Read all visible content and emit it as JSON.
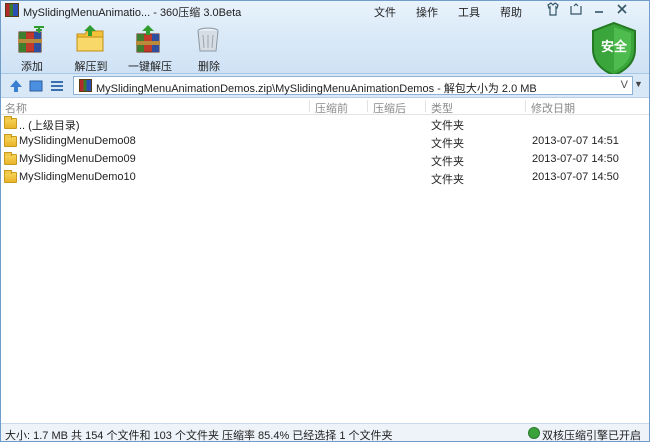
{
  "window": {
    "title": "MySlidingMenuAnimatio... - 360压缩 3.0Beta"
  },
  "menu": {
    "items": [
      "文件",
      "操作",
      "工具",
      "帮助"
    ]
  },
  "toolbar": {
    "add_label": "添加",
    "extract_to_label": "解压到",
    "one_click_extract_label": "一键解压",
    "delete_label": "删除"
  },
  "security": {
    "label": "安全"
  },
  "address": {
    "path": "MySlidingMenuAnimationDemos.zip\\MySlidingMenuAnimationDemos - 解包大小为 2.0 MB",
    "dropdown_glyph": "V"
  },
  "columns": {
    "name": "名称",
    "compressed": "压缩前",
    "after": "压缩后",
    "type": "类型",
    "modified": "修改日期"
  },
  "files": [
    {
      "name": ".. (上级目录)",
      "type": "文件夹",
      "modified": ""
    },
    {
      "name": "MySlidingMenuDemo08",
      "type": "文件夹",
      "modified": "2013-07-07 14:51"
    },
    {
      "name": "MySlidingMenuDemo09",
      "type": "文件夹",
      "modified": "2013-07-07 14:50"
    },
    {
      "name": "MySlidingMenuDemo10",
      "type": "文件夹",
      "modified": "2013-07-07 14:50"
    }
  ],
  "status": {
    "summary": "大小: 1.7 MB 共 154 个文件和 103 个文件夹 压缩率 85.4% 已经选择 1 个文件夹",
    "engine": "双核压缩引擎已开启"
  },
  "colors": {
    "chrome_top": "#e9f3fc",
    "chrome_bottom": "#cfe2f5",
    "shield_green": "#3aa53a",
    "folder_yellow": "#f2c84a"
  },
  "icons": [
    "app-icon",
    "add-icon",
    "extract-icon",
    "one-click-extract-icon",
    "delete-icon",
    "shield-icon",
    "up-arrow-icon",
    "view-icon",
    "list-view-icon",
    "folder-icon",
    "engine-icon"
  ]
}
